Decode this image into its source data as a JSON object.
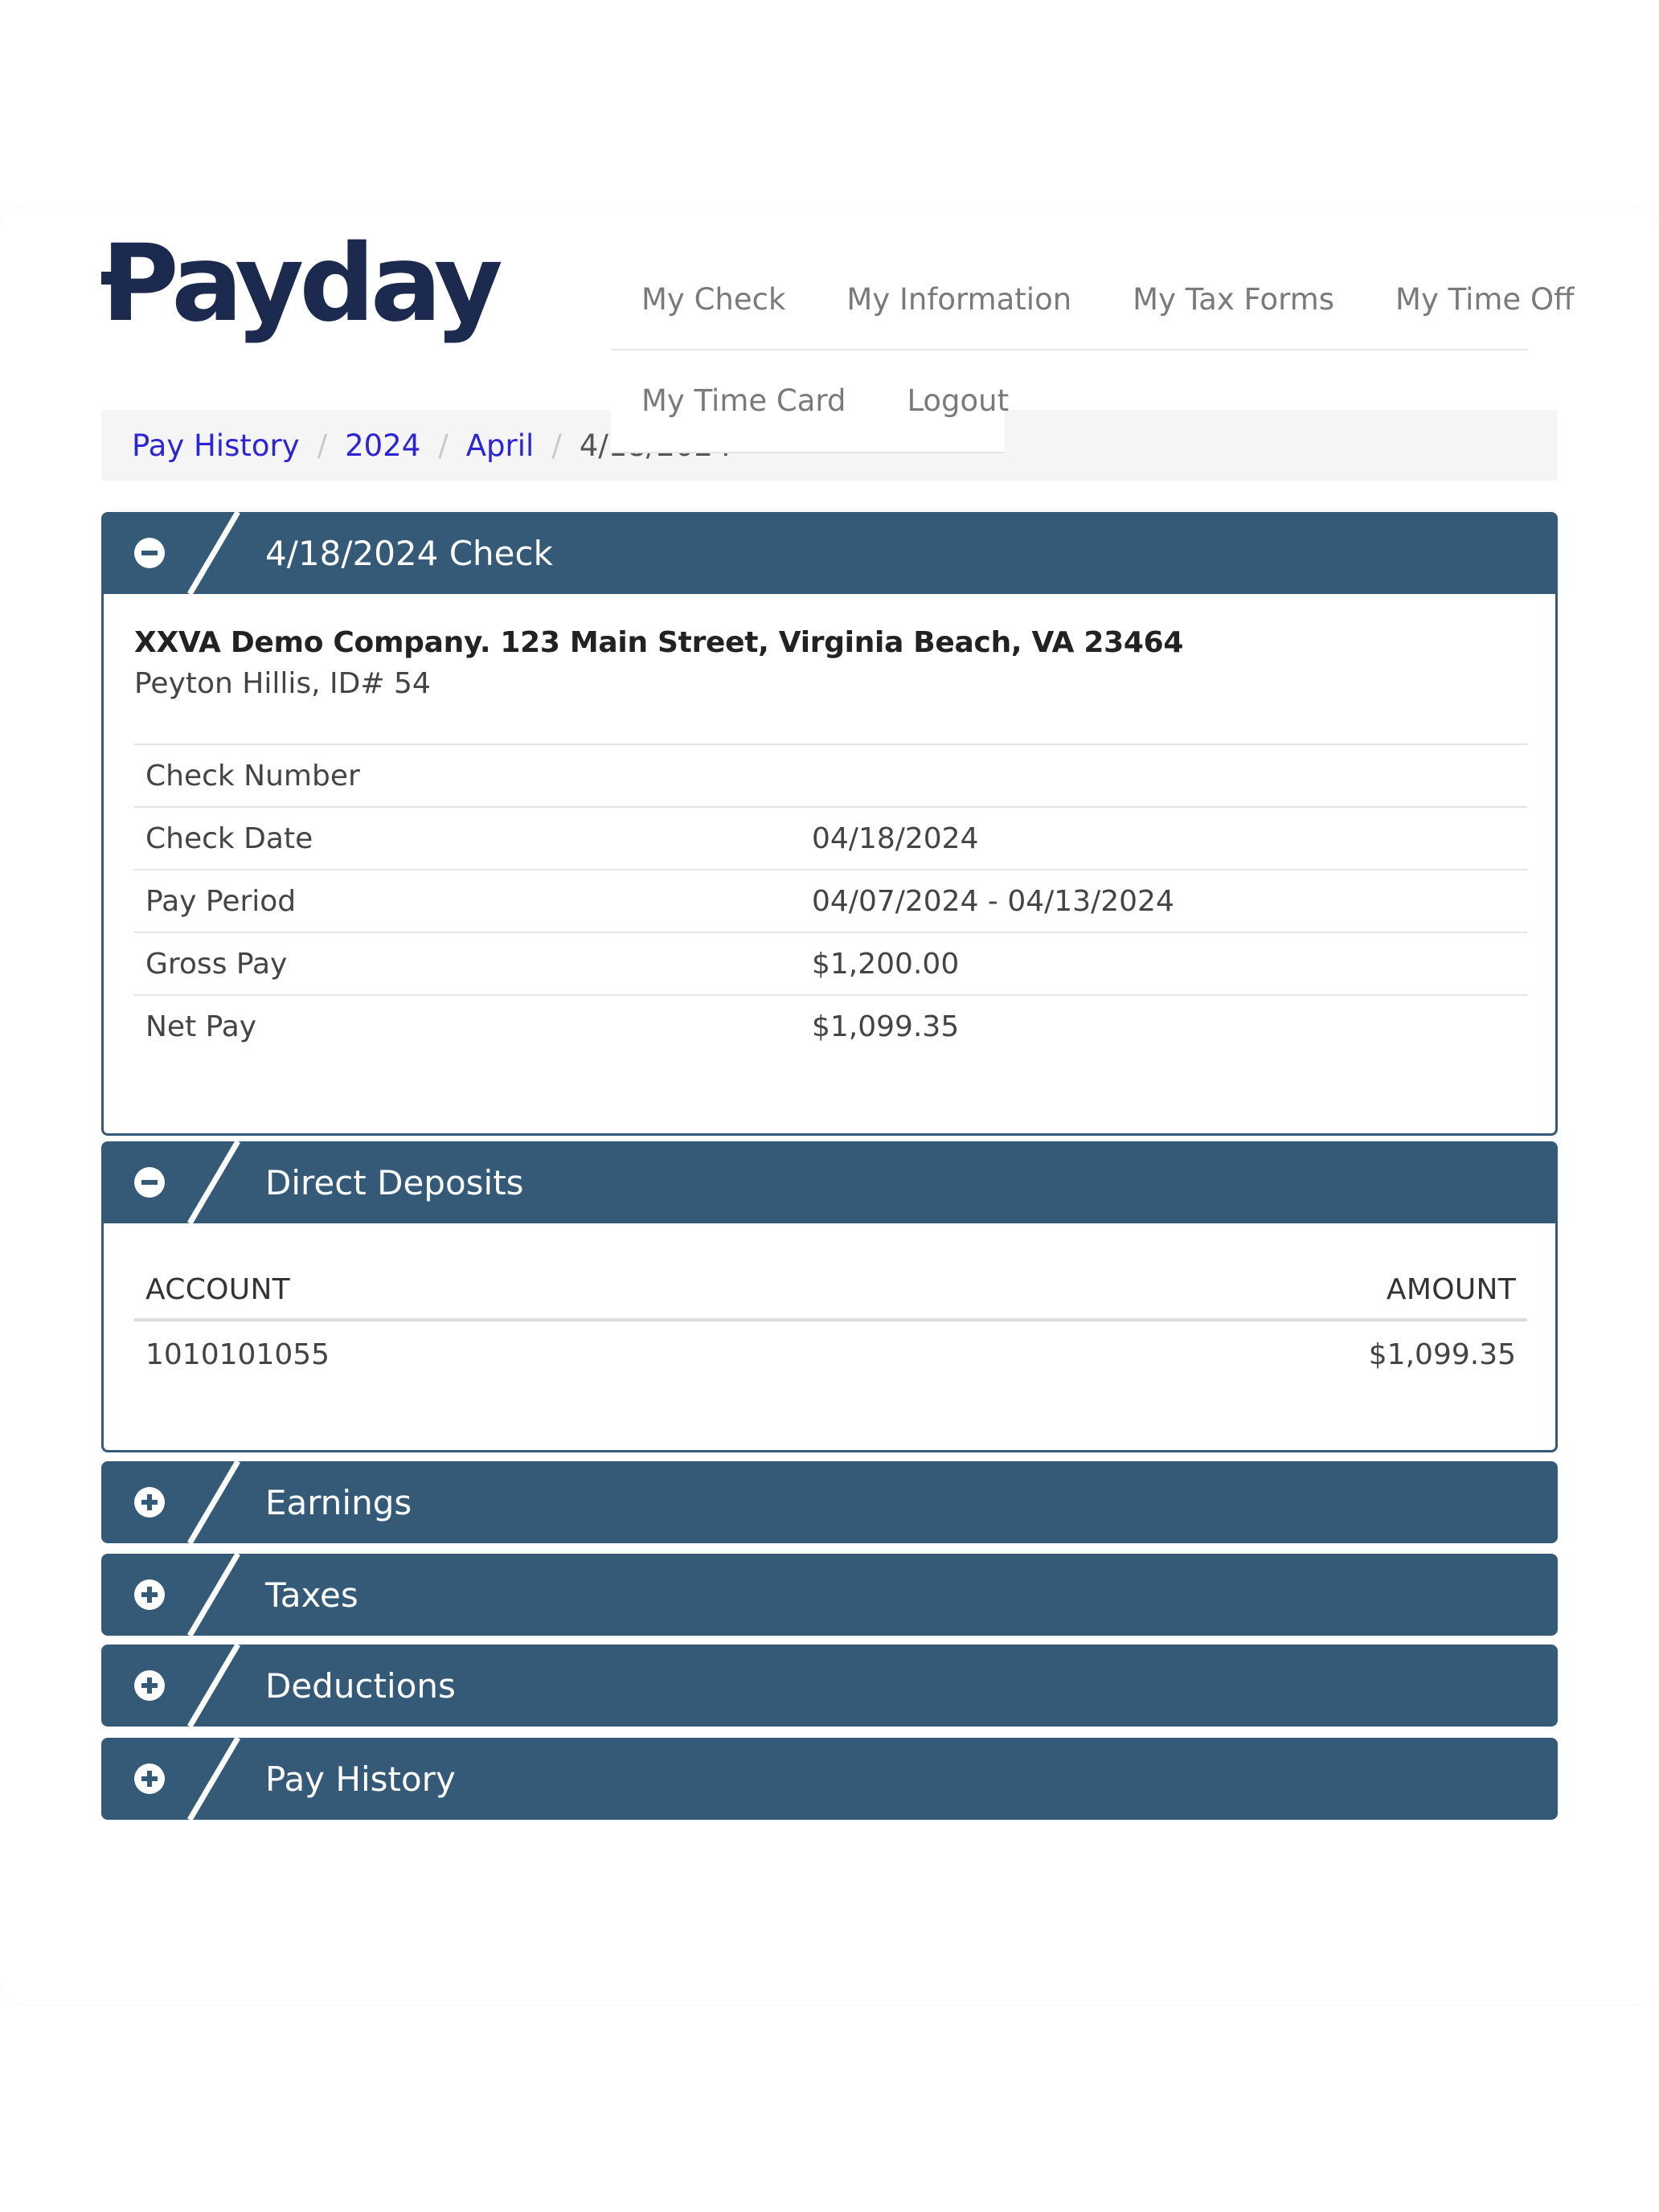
{
  "logo": {
    "text": "Payday"
  },
  "nav": {
    "items": [
      "My Check",
      "My Information",
      "My Tax Forms",
      "My Time Off",
      "My Time Card",
      "Logout"
    ]
  },
  "breadcrumb": {
    "items": [
      "Pay History",
      "2024",
      "April"
    ],
    "current": "4/18/2024"
  },
  "check_panel": {
    "title": "4/18/2024 Check",
    "company": "XXVA Demo Company. 123 Main Street, Virginia Beach, VA 23464",
    "employee": "Peyton Hillis, ID# 54",
    "rows": [
      {
        "label": "Check Number",
        "value": ""
      },
      {
        "label": "Check Date",
        "value": "04/18/2024"
      },
      {
        "label": "Pay Period",
        "value": "04/07/2024 - 04/13/2024"
      },
      {
        "label": "Gross Pay",
        "value": "$1,200.00"
      },
      {
        "label": "Net Pay",
        "value": "$1,099.35"
      }
    ]
  },
  "direct_deposits": {
    "title": "Direct Deposits",
    "headers": {
      "account": "ACCOUNT",
      "amount": "AMOUNT"
    },
    "rows": [
      {
        "account": "1010101055",
        "amount": "$1,099.35"
      }
    ]
  },
  "collapsed_panels": [
    {
      "title": "Earnings",
      "icon": "plus-circle-icon"
    },
    {
      "title": "Taxes",
      "icon": "plus-circle-icon"
    },
    {
      "title": "Deductions",
      "icon": "plus-circle-icon"
    },
    {
      "title": "Pay History",
      "icon": "plus-circle-icon"
    }
  ],
  "colors": {
    "panel_header": "#345a77",
    "logo": "#1b2a4e",
    "link": "#2b25d6"
  }
}
